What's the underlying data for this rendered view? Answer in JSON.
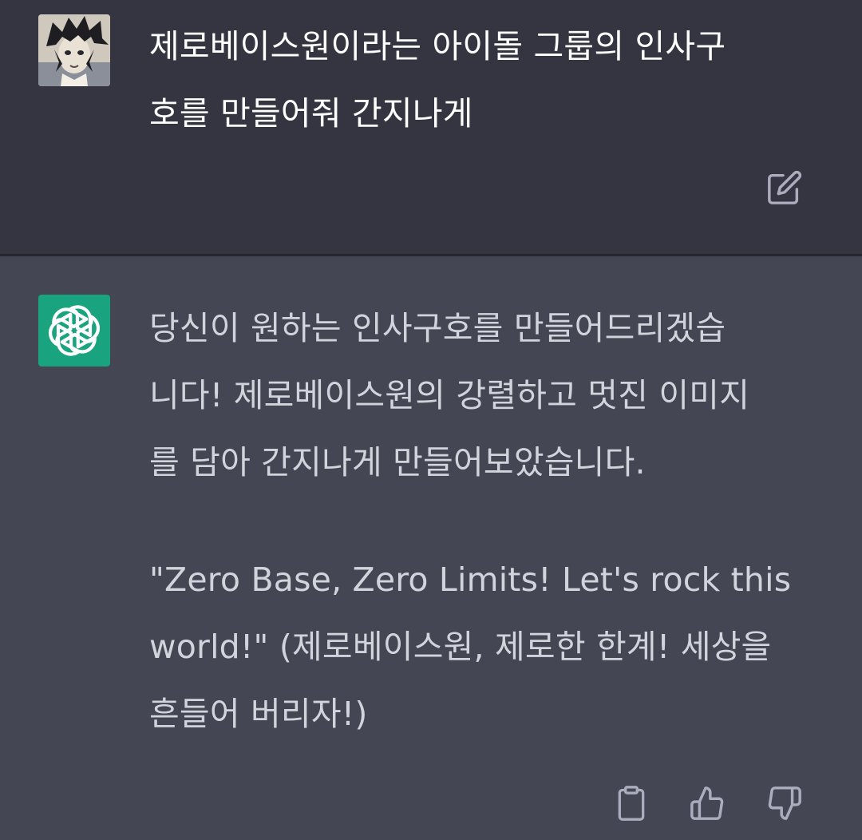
{
  "user_message": {
    "line1": "제로베이스원이라는 아이돌 그룹의 인사구",
    "line2": "호를 만들어줘 간지나게"
  },
  "assistant_message": {
    "paragraph1": {
      "line1": "당신이 원하는 인사구호를 만들어드리겠습",
      "line2": "니다! 제로베이스원의 강렬하고 멋진 이미지",
      "line3": "를 담아 간지나게 만들어보았습니다."
    },
    "paragraph2": {
      "line1": "\"Zero Base, Zero Limits! Let's rock this",
      "line2": "world!\" (제로베이스원, 제로한 한계! 세상을",
      "line3": "흔들어 버리자!)"
    }
  },
  "icons": {
    "user_avatar": "anime-character-avatar",
    "assistant_avatar": "openai-logo-icon",
    "edit": "edit-icon",
    "copy": "clipboard-icon",
    "thumbs_up": "thumbs-up-icon",
    "thumbs_down": "thumbs-down-icon"
  },
  "colors": {
    "user_bg": "#343541",
    "assistant_bg": "#444654",
    "assistant_avatar_bg": "#19a37f",
    "icon_color": "#acacbe"
  }
}
